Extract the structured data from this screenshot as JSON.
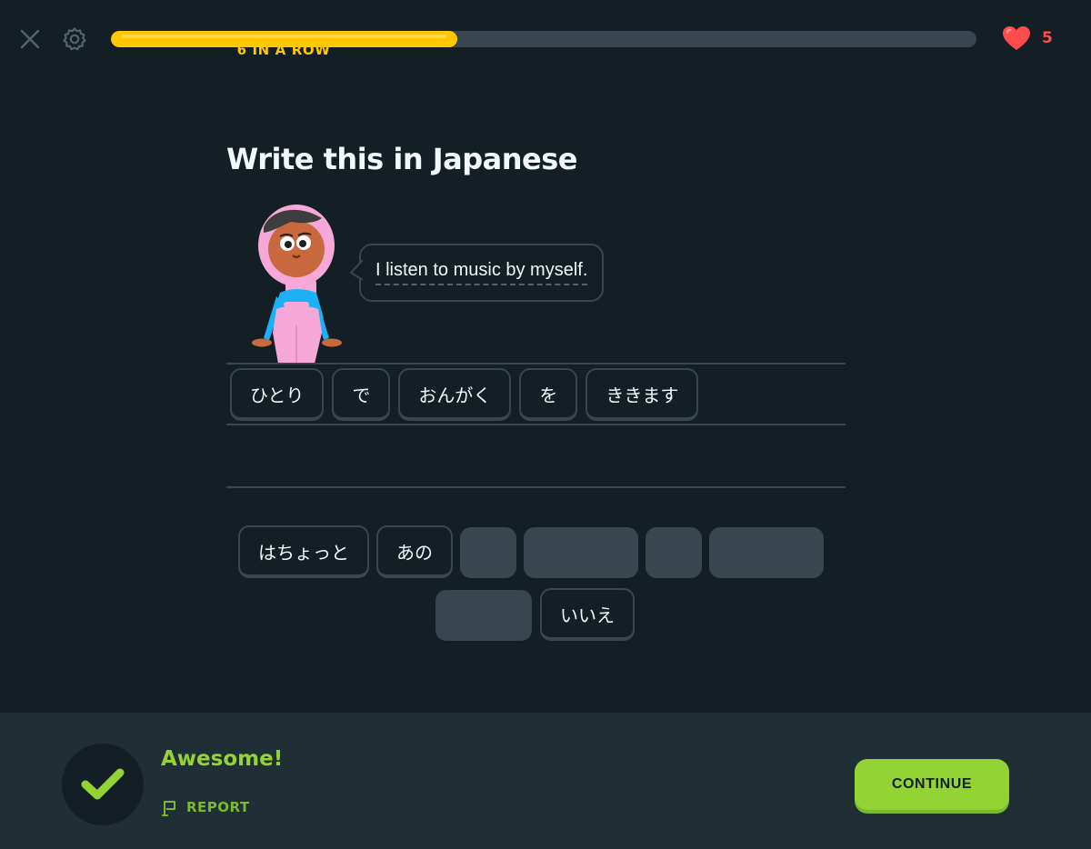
{
  "header": {
    "streak_label": "6 IN A ROW",
    "progress_fraction": 0.4,
    "hearts_count": "5",
    "progress_color": "#ffc800",
    "heart_color": "#ff4b4b"
  },
  "prompt": {
    "title": "Write this in Japanese",
    "sentence": "I listen to music by myself."
  },
  "answer": {
    "selected_words": [
      "ひとり",
      "で",
      "おんがく",
      "を",
      "ききます"
    ]
  },
  "word_bank": {
    "row1": [
      {
        "label": "はちょっと",
        "used": false
      },
      {
        "label": "あの",
        "used": false
      },
      {
        "label": "",
        "used": true,
        "size": "s"
      },
      {
        "label": "",
        "used": true,
        "size": "l"
      },
      {
        "label": "",
        "used": true,
        "size": "s"
      },
      {
        "label": "",
        "used": true,
        "size": "l"
      }
    ],
    "row2": [
      {
        "label": "",
        "used": true,
        "size": "m"
      },
      {
        "label": "いいえ",
        "used": false
      }
    ]
  },
  "footer": {
    "feedback": "Awesome!",
    "report_label": "REPORT",
    "continue_label": "CONTINUE",
    "accent_color": "#93d333"
  }
}
